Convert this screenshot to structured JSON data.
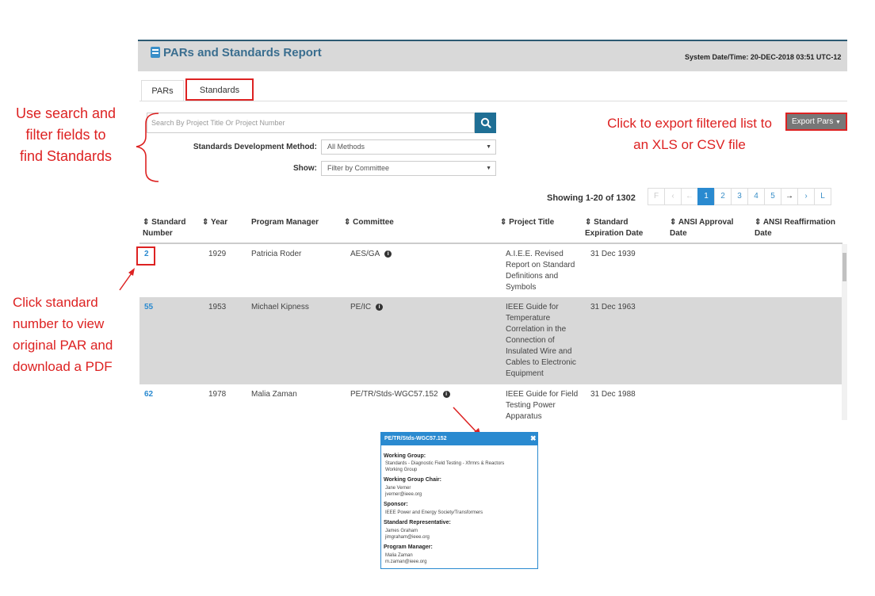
{
  "app": {
    "title": "PARs and Standards Report",
    "system_datetime": "System Date/Time: 20-DEC-2018  03:51 UTC-12"
  },
  "tabs": [
    {
      "label": "PARs",
      "active": false
    },
    {
      "label": "Standards",
      "active": true
    }
  ],
  "search": {
    "placeholder": "Search By Project Title Or Project Number",
    "value": ""
  },
  "filters": {
    "sdm_label": "Standards Development Method:",
    "sdm_value": "All Methods",
    "show_label": "Show:",
    "show_value": "Filter by Committee"
  },
  "export_button": "Export Pars",
  "pagination": {
    "showing": "Showing 1-20 of 1302",
    "buttons": [
      "F",
      "‹",
      "←",
      "1",
      "2",
      "3",
      "4",
      "5",
      "→",
      "›",
      "L"
    ],
    "current": "1"
  },
  "table": {
    "headers": [
      "Standard Number",
      "Year",
      "Program Manager",
      "Committee",
      "Project Title",
      "Standard Expiration Date",
      "ANSI Approval Date",
      "ANSI Reaffirmation Date"
    ],
    "rows": [
      {
        "number": "2",
        "year": "1929",
        "manager": "Patricia Roder",
        "committee": "AES/GA",
        "title": "A.I.E.E. Revised Report on Standard Definitions and Symbols",
        "expiration": "31 Dec 1939",
        "ansi_approval": "",
        "ansi_reaffirm": ""
      },
      {
        "number": "55",
        "year": "1953",
        "manager": "Michael Kipness",
        "committee": "PE/IC",
        "title": "IEEE Guide for Temperature Correlation in the Connection of Insulated Wire and Cables to Electronic Equipment",
        "expiration": "31 Dec 1963",
        "ansi_approval": "",
        "ansi_reaffirm": ""
      },
      {
        "number": "62",
        "year": "1978",
        "manager": "Malia Zaman",
        "committee": "PE/TR/Stds-WGC57.152",
        "title": "IEEE Guide for Field Testing Power Apparatus",
        "expiration": "31 Dec 1988",
        "ansi_approval": "",
        "ansi_reaffirm": ""
      }
    ]
  },
  "annotations": {
    "search": "Use search and filter fields to find Standards",
    "export": "Click to export filtered list to an XLS or CSV file",
    "click_number": "Click standard number to view original PAR and download a PDF"
  },
  "popup": {
    "title": "PE/TR/Stds-WGC57.152",
    "close": "✖",
    "working_group_label": "Working Group:",
    "working_group_value1": "Standards - Diagnostic Field Testing - Xfrmrs & Reactors",
    "working_group_value2": "Working Group",
    "chair_label": "Working Group Chair:",
    "chair_name": "Jane Verner",
    "chair_email": "jverner@ieee.org",
    "sponsor_label": "Sponsor:",
    "sponsor_value": "IEEE Power and Energy Society/Transformers",
    "rep_label": "Standard Representative:",
    "rep_name": "James Graham",
    "rep_email": "jimgraham@ieee.org",
    "pm_label": "Program Manager:",
    "pm_name": "Malia Zaman",
    "pm_email": "m.zaman@ieee.org"
  },
  "colors": {
    "accent": "#2a8ad0",
    "annotation": "#dd2222",
    "header_bar": "#d9d9d9"
  }
}
